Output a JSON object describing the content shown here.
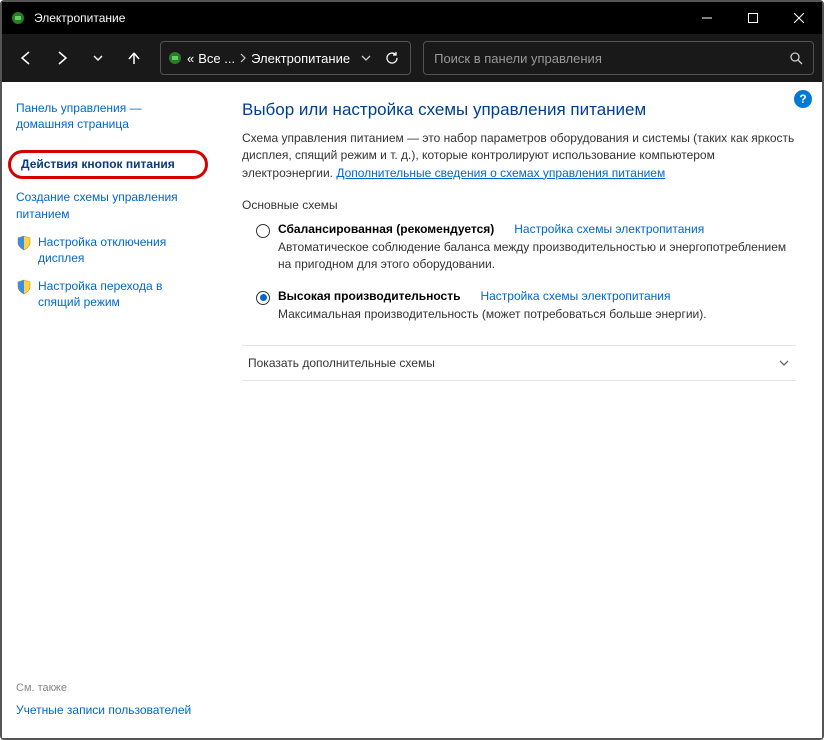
{
  "window": {
    "title": "Электропитание"
  },
  "address": {
    "prefix": "«",
    "crumb1": "Все ...",
    "crumb2": "Электропитание"
  },
  "search": {
    "placeholder": "Поиск в панели управления"
  },
  "sidebar": {
    "home": "Панель управления — домашняя страница",
    "highlighted": "Действия кнопок питания",
    "links": [
      "Создание схемы управления питанием",
      "Настройка отключения дисплея",
      "Настройка перехода в спящий режим"
    ],
    "see_also_hdr": "См. также",
    "see_also_link": "Учетные записи пользователей"
  },
  "main": {
    "heading": "Выбор или настройка схемы управления питанием",
    "intro_text": "Схема управления питанием — это набор параметров оборудования и системы (таких как яркость дисплея, спящий режим и т. д.), которые контролируют использование компьютером электроэнергии. ",
    "intro_link": "Дополнительные сведения о схемах управления питанием",
    "section_hdr": "Основные схемы",
    "plans": [
      {
        "name": "Сбалансированная (рекомендуется)",
        "desc": "Автоматическое соблюдение баланса между производительностью и энергопотреблением на пригодном для этого оборудовании.",
        "config": "Настройка схемы электропитания",
        "checked": false
      },
      {
        "name": "Высокая производительность",
        "desc": "Максимальная производительность (может потребоваться больше энергии).",
        "config": "Настройка схемы электропитания",
        "checked": true
      }
    ],
    "expander": "Показать дополнительные схемы"
  }
}
